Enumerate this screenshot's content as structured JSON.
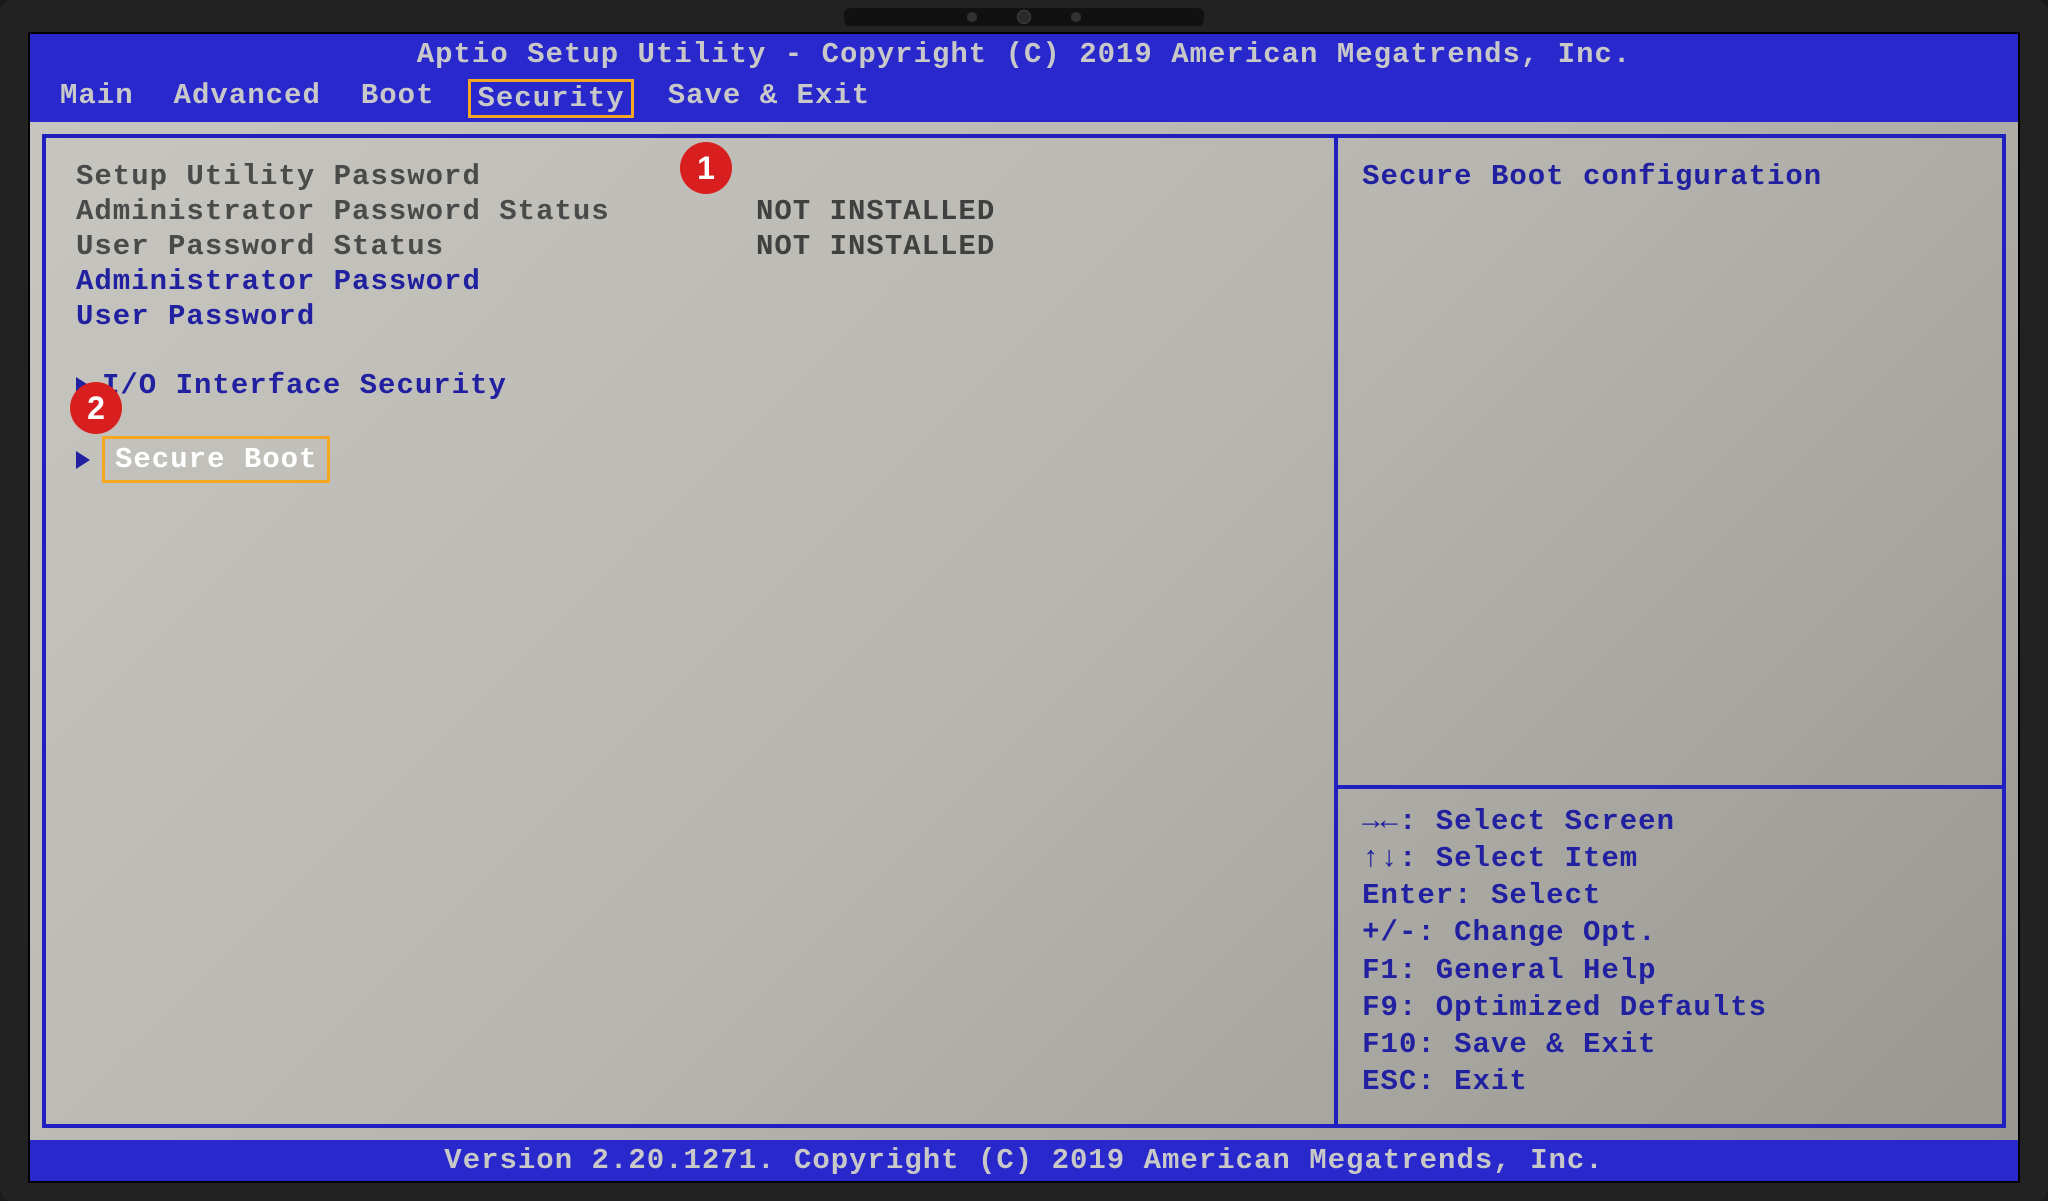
{
  "header": {
    "title": "Aptio Setup Utility - Copyright (C) 2019 American Megatrends, Inc."
  },
  "menu": {
    "items": [
      {
        "label": "Main",
        "active": false
      },
      {
        "label": "Advanced",
        "active": false
      },
      {
        "label": "Boot",
        "active": false
      },
      {
        "label": "Security",
        "active": true
      },
      {
        "label": "Save & Exit",
        "active": false
      }
    ]
  },
  "main_panel": {
    "section_title": "Setup Utility Password",
    "admin_pw_status_label": "Administrator Password Status",
    "admin_pw_status_value": "NOT INSTALLED",
    "user_pw_status_label": "User Password Status",
    "user_pw_status_value": "NOT INSTALLED",
    "admin_pw_label": "Administrator Password",
    "user_pw_label": "User Password",
    "io_security_label": "I/O Interface Security",
    "secure_boot_label": "Secure Boot"
  },
  "side_panel": {
    "help_text": "Secure Boot configuration",
    "keys": {
      "select_screen": "→←: Select Screen",
      "select_item": "↑↓: Select Item",
      "enter": "Enter: Select",
      "change": "+/-: Change Opt.",
      "f1": "F1: General Help",
      "f9": "F9: Optimized Defaults",
      "f10": "F10: Save & Exit",
      "esc": "ESC: Exit"
    }
  },
  "footer": {
    "text": "Version 2.20.1271. Copyright (C) 2019 American Megatrends, Inc."
  },
  "annotations": {
    "callout1": "1",
    "callout2": "2"
  }
}
